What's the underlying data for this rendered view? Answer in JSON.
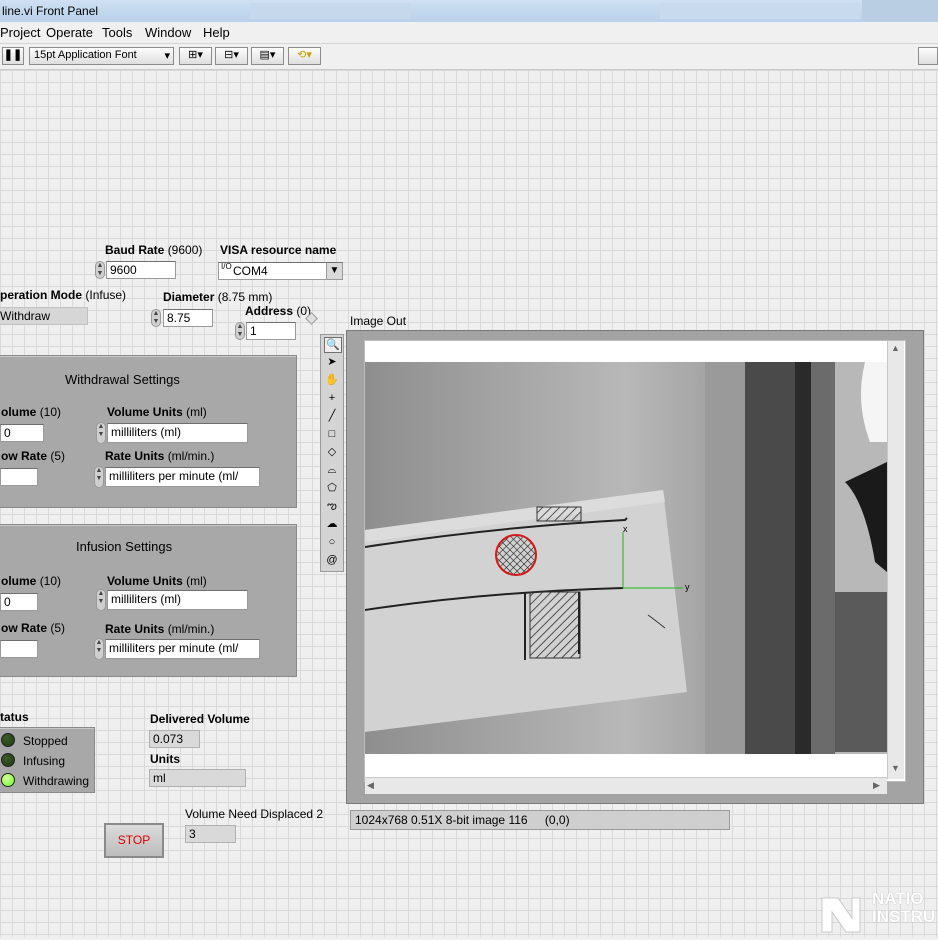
{
  "window": {
    "title": "line.vi Front Panel"
  },
  "menu": [
    "Project",
    "Operate",
    "Tools",
    "Window",
    "Help"
  ],
  "toolbar": {
    "font_select": "15pt Application Font"
  },
  "baud_rate": {
    "label": "Baud Rate",
    "default": "(9600)",
    "value": "9600"
  },
  "visa": {
    "label": "VISA resource name",
    "value": "COM4",
    "prefix": "I/O"
  },
  "operation_mode": {
    "label": "peration Mode",
    "default": "(Infuse)",
    "value": "Withdraw"
  },
  "diameter": {
    "label": "Diameter",
    "default": "(8.75 mm)",
    "value": "8.75"
  },
  "address": {
    "label": "Address",
    "default": "(0)",
    "value": "1"
  },
  "image_out": {
    "label": "Image Out"
  },
  "withdrawal": {
    "title": "Withdrawal Settings",
    "volume_label": "olume",
    "volume_default": "(10)",
    "volume_value": "0",
    "flow_label": "ow Rate",
    "flow_default": "(5)",
    "flow_value": "",
    "vol_units_label": "Volume Units",
    "vol_units_default": "(ml)",
    "vol_units_value": "milliliters (ml)",
    "rate_units_label": "Rate Units",
    "rate_units_default": "(ml/min.)",
    "rate_units_value": "milliliters per minute (ml/"
  },
  "infusion": {
    "title": "Infusion Settings",
    "volume_label": "olume",
    "volume_default": "(10)",
    "volume_value": "0",
    "flow_label": "ow Rate",
    "flow_default": "(5)",
    "flow_value": "",
    "vol_units_label": "Volume Units",
    "vol_units_default": "(ml)",
    "vol_units_value": "milliliters (ml)",
    "rate_units_label": "Rate Units",
    "rate_units_default": "(ml/min.)",
    "rate_units_value": "milliliters per minute (ml/"
  },
  "status": {
    "label": "tatus",
    "items": [
      {
        "label": "Stopped",
        "color": "#1f3b12"
      },
      {
        "label": "Infusing",
        "color": "#1f3b12"
      },
      {
        "label": "Withdrawing",
        "color": "#6dff2a"
      }
    ]
  },
  "delivered": {
    "label": "Delivered Volume",
    "value": "0.073",
    "units_label": "Units",
    "units_value": "ml"
  },
  "volume_need": {
    "label": "Volume Need Displaced 2",
    "value": "3"
  },
  "stop_button": {
    "label": "STOP"
  },
  "image_info": {
    "text": "1024x768 0.51X 8-bit image 116",
    "coords": "(0,0)"
  },
  "overlay_axes": {
    "x_label": "x",
    "y_label": "y"
  },
  "watermark": "NATIONAL INSTRUMENTS"
}
